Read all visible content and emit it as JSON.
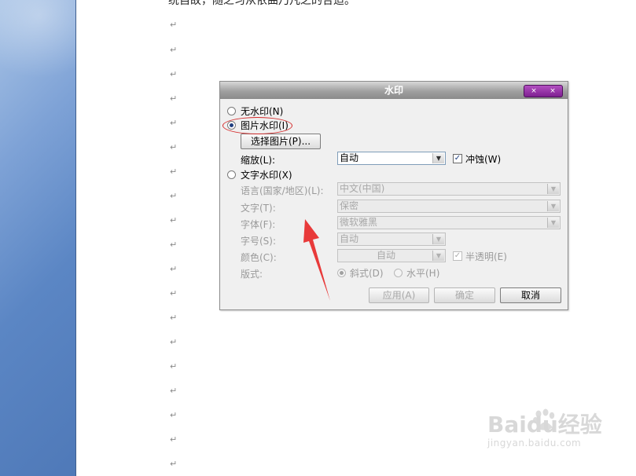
{
  "document": {
    "top_text": "统自故，随之习从依曲乃凡之的合适。",
    "paragraph_mark": "↵"
  },
  "dialog": {
    "title": "水印",
    "window_buttons": [
      "×",
      "×"
    ],
    "options": {
      "none": "无水印(N)",
      "picture": "图片水印(I)",
      "text": "文字水印(X)"
    },
    "select_picture_button": "选择图片(P)...",
    "scale": {
      "label": "缩放(L):",
      "value": "自动"
    },
    "washout": {
      "label": "冲蚀(W)",
      "checked": true
    },
    "language": {
      "label": "语言(国家/地区)(L):",
      "value": "中文(中国)"
    },
    "text_field": {
      "label": "文字(T):",
      "value": "保密"
    },
    "font": {
      "label": "字体(F):",
      "value": "微软雅黑"
    },
    "size": {
      "label": "字号(S):",
      "value": "自动"
    },
    "color": {
      "label": "颜色(C):",
      "value": "自动"
    },
    "semitransparent": {
      "label": "半透明(E)",
      "checked": true
    },
    "layout": {
      "label": "版式:",
      "diagonal": "斜式(D)",
      "horizontal": "水平(H)"
    },
    "buttons": {
      "apply": "应用(A)",
      "ok": "确定",
      "cancel": "取消"
    }
  },
  "watermark": {
    "brand": "Baidu经验",
    "url": "jingyan.baidu.com"
  },
  "colors": {
    "annotation": "#d42a2a",
    "title_bar": "#9a9a9a",
    "close_buttons": "#8e2aa3"
  }
}
